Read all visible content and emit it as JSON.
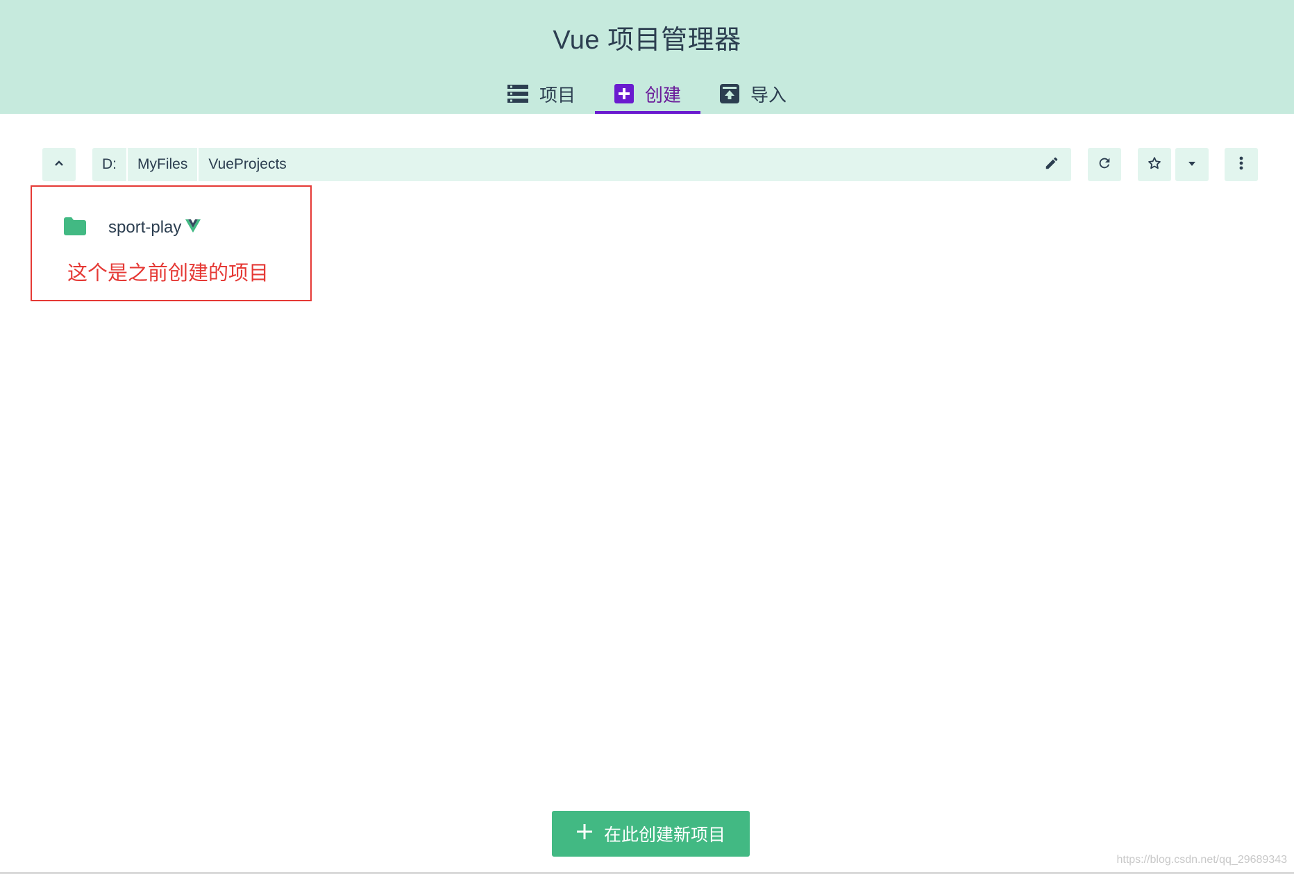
{
  "app": {
    "title": "Vue 项目管理器"
  },
  "tabs": [
    {
      "label": "项目",
      "icon": "list-icon"
    },
    {
      "label": "创建",
      "icon": "add-box-icon",
      "active": true
    },
    {
      "label": "导入",
      "icon": "unarchive-icon"
    }
  ],
  "path": {
    "segments": [
      "D:",
      "MyFiles",
      "VueProjects"
    ]
  },
  "toolbar": {
    "up_icon": "chevron-up-icon",
    "edit_icon": "pencil-icon",
    "refresh_icon": "refresh-icon",
    "favorite_icon": "star-outline-icon",
    "favorites_dropdown_icon": "caret-down-icon",
    "more_icon": "more-vert-icon"
  },
  "folders": [
    {
      "name": "sport-play",
      "icon": "folder-icon",
      "badge": "vue-logo-icon"
    }
  ],
  "annotation": {
    "text": "这个是之前创建的项目",
    "color": "#e53935"
  },
  "create_button": {
    "label": "在此创建新项目",
    "icon": "plus-icon"
  },
  "watermark": "https://blog.csdn.net/qq_29689343",
  "colors": {
    "header_bg": "#c6eadd",
    "toolbar_bg": "#e2f5ee",
    "accent_purple": "#6a1bcf",
    "vue_green": "#42b983",
    "text": "#2c3e50"
  }
}
